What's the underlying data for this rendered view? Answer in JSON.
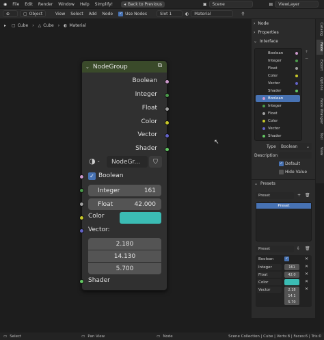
{
  "menu": [
    "File",
    "Edit",
    "Render",
    "Window",
    "Help",
    "Simplify!"
  ],
  "back_button": "Back to Previous",
  "scene": "Scene",
  "view_layer": "ViewLayer",
  "header": {
    "mode": "Object",
    "items": [
      "View",
      "Select",
      "Add",
      "Node"
    ],
    "use_nodes": "Use Nodes",
    "slot": "Slot 1",
    "material": "Material"
  },
  "breadcrumb": [
    "Cube",
    "Cube",
    "Material"
  ],
  "node": {
    "title": "NodeGroup",
    "outputs": [
      "Boolean",
      "Integer",
      "Float",
      "Color",
      "Vector",
      "Shader"
    ],
    "group_name": "NodeGr...",
    "boolean_label": "Boolean",
    "integer_label": "Integer",
    "integer_value": "161",
    "float_label": "Float",
    "float_value": "42.000",
    "color_label": "Color",
    "vector_label": "Vector:",
    "vector_values": [
      "2.180",
      "14.130",
      "5.700"
    ],
    "shader_label": "Shader"
  },
  "panel": {
    "node_tab": "Node",
    "properties": "Properties",
    "interface": "Interface",
    "outputs": [
      "Boolean",
      "Integer",
      "Float",
      "Color",
      "Vector",
      "Shader"
    ],
    "inputs": [
      "Boolean",
      "Integer",
      "Float",
      "Color",
      "Vector",
      "Shader"
    ],
    "type_label": "Type",
    "type_value": "Boolean",
    "description_label": "Description",
    "default_label": "Default",
    "hide_value_label": "Hide Value",
    "presets_header": "Presets",
    "preset_placeholder": "Preset",
    "preset_item": "Preset",
    "preset_field2": "Preset",
    "values": {
      "boolean": "Boolean",
      "integer": "Integer",
      "integer_value": "161",
      "float": "Float",
      "float_value": "42.0",
      "color": "Color",
      "vector": "Vector",
      "vector_values": [
        "2.18",
        "14.1",
        "5.70"
      ]
    }
  },
  "side_tabs": [
    "Catalog",
    "Node",
    "Export",
    "Options",
    "Node Wrangler",
    "Tool",
    "View"
  ],
  "status": {
    "select": "Select",
    "pan": "Pan View",
    "node": "Node",
    "info": "Scene Collection | Cube | Verts:8 | Faces:6 | Tris:0"
  },
  "colors": {
    "node_header": "#3a4a2a",
    "boolean_socket": "#cc99cc",
    "integer_socket": "#4a9a4a",
    "float_socket": "#a1a1a1",
    "color_socket": "#c7c729",
    "vector_socket": "#6363c7",
    "shader_socket": "#63c763",
    "color_swatch": "#3bbcb4",
    "selection": "#4772b3"
  }
}
